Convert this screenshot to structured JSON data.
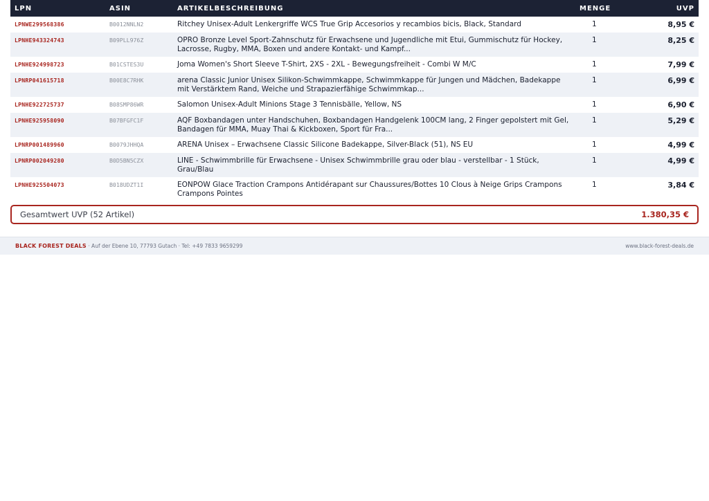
{
  "table": {
    "headers": {
      "lpn": "LPN",
      "asin": "ASIN",
      "description": "ARTIKELBESCHREIBUNG",
      "quantity": "MENGE",
      "uvp": "UVP"
    },
    "rows": [
      {
        "lpn": "LPNWE299568386",
        "asin": "B0012NNLN2",
        "description": "Ritchey Unisex-Adult Lenkergriffe WCS True Grip Accesorios y recambios bicis, Black, Standard",
        "quantity": "1",
        "uvp": "8,95 €"
      },
      {
        "lpn": "LPNHE943324743",
        "asin": "B09PLL976Z",
        "description": "OPRO Bronze Level Sport-Zahnschutz für Erwachsene und Jugendliche mit Etui, Gummischutz für Hockey, Lacrosse, Rugby, MMA, Boxen und andere Kontakt- und Kampf...",
        "quantity": "1",
        "uvp": "8,25 €"
      },
      {
        "lpn": "LPNHE924998723",
        "asin": "B01CSTES3U",
        "description": "Joma Women's Short Sleeve T-Shirt, 2XS - 2XL - Bewegungsfreiheit - Combi W M/C",
        "quantity": "1",
        "uvp": "7,99 €"
      },
      {
        "lpn": "LPNRP041615718",
        "asin": "B00E8C7RHK",
        "description": "arena Classic Junior Unisex Silikon-Schwimmkappe, Schwimmkappe für Jungen und Mädchen, Badekappe mit Verstärktem Rand, Weiche und Strapazierfähige Schwimmkap...",
        "quantity": "1",
        "uvp": "6,99 €"
      },
      {
        "lpn": "LPNHE922725737",
        "asin": "B08SMP86WR",
        "description": "Salomon Unisex-Adult Minions Stage 3 Tennisbälle, Yellow, NS",
        "quantity": "1",
        "uvp": "6,90 €"
      },
      {
        "lpn": "LPNHE925958090",
        "asin": "B07BFGFC1F",
        "description": "AQF Boxbandagen unter Handschuhen, Boxbandagen Handgelenk 100CM lang, 2 Finger gepolstert mit Gel, Bandagen für MMA, Muay Thai & Kickboxen, Sport für Fra...",
        "quantity": "1",
        "uvp": "5,29 €"
      },
      {
        "lpn": "LPNRP001489960",
        "asin": "B0079JHHQA",
        "description": "ARENA Unisex – Erwachsene Classic Silicone Badekappe, Silver-Black (51), NS EU",
        "quantity": "1",
        "uvp": "4,99 €"
      },
      {
        "lpn": "LPNRP002049280",
        "asin": "B0D5BN5CZX",
        "description": "LINE - Schwimmbrille für Erwachsene - Unisex Schwimmbrille grau oder blau - verstellbar - 1 Stück, Grau/Blau",
        "quantity": "1",
        "uvp": "4,99 €"
      },
      {
        "lpn": "LPNHE925504073",
        "asin": "B018UDZT1I",
        "description": "EONPOW Glace Traction Crampons Antidérapant sur Chaussures/Bottes 10 Clous à Neige Grips Crampons Crampons Pointes",
        "quantity": "1",
        "uvp": "3,84 €"
      }
    ]
  },
  "total": {
    "label": "Gesamtwert UVP (52 Artikel)",
    "value": "1.380,35 €"
  },
  "footer": {
    "brand": "BLACK FOREST DEALS",
    "address": " · Auf der Ebene 10, 77793 Gutach · Tel: +49 7833 9659299",
    "website": "www.black-forest-deals.de"
  },
  "colors": {
    "header_bg": "#1c2234",
    "accent_red": "#a8251f",
    "row_alt": "#eef1f6"
  }
}
